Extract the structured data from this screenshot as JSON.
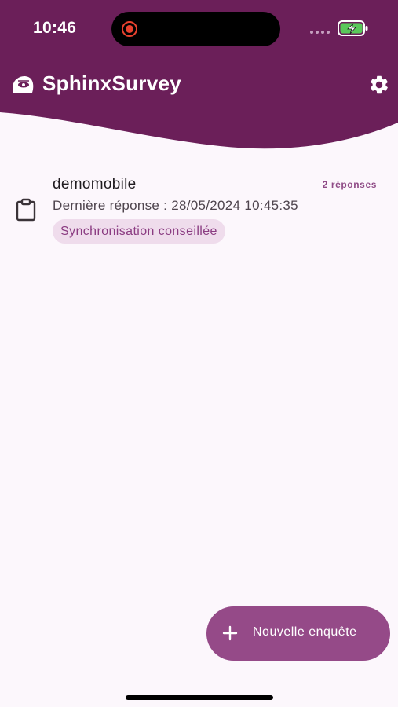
{
  "status_bar": {
    "time": "10:46"
  },
  "header": {
    "app_title": "SphinxSurvey",
    "logo_icon": "sphinx-eye-logo-icon",
    "settings_icon": "gear-icon"
  },
  "surveys": [
    {
      "name": "demomobile",
      "last_response": "Dernière réponse : 28/05/2024 10:45:35",
      "responses_count": "2 réponses",
      "status_chip": "Synchronisation conseillée",
      "icon": "clipboard-icon"
    }
  ],
  "fab": {
    "label": "Nouvelle enquête",
    "icon": "plus-icon"
  },
  "colors": {
    "primary": "#6b1f59",
    "fab": "#954a88",
    "chip_bg": "#efdcec",
    "chip_text": "#8b3c82",
    "background": "#fcf7fc"
  }
}
